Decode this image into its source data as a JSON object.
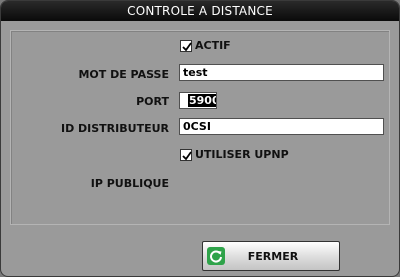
{
  "dialog": {
    "title": "CONTROLE A DISTANCE"
  },
  "form": {
    "actif": {
      "label": "ACTIF",
      "checked": true
    },
    "password": {
      "label": "MOT DE PASSE",
      "value": "test"
    },
    "port": {
      "label": "PORT",
      "value": "5900"
    },
    "distributor_id": {
      "label": "ID DISTRIBUTEUR",
      "value": "0CSI"
    },
    "upnp": {
      "label": "UTILISER UPNP",
      "checked": true
    },
    "public_ip": {
      "label": "IP PUBLIQUE",
      "value": ""
    }
  },
  "footer": {
    "close_label": "FERMER",
    "close_icon": "refresh-icon",
    "close_icon_color": "#2fa34a"
  }
}
